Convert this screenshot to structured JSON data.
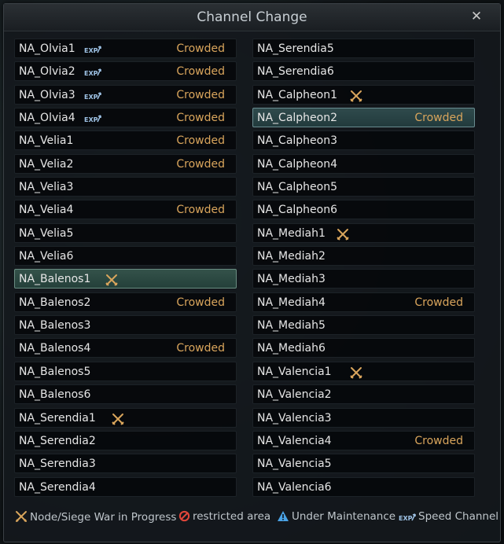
{
  "window": {
    "title": "Channel Change"
  },
  "left_channels": [
    {
      "name": "NA_Olvia1",
      "status": "Crowded",
      "exp": true
    },
    {
      "name": "NA_Olvia2",
      "status": "Crowded",
      "exp": true
    },
    {
      "name": "NA_Olvia3",
      "status": "Crowded",
      "exp": true
    },
    {
      "name": "NA_Olvia4",
      "status": "Crowded",
      "exp": true
    },
    {
      "name": "NA_Velia1",
      "status": "Crowded"
    },
    {
      "name": "NA_Velia2",
      "status": "Crowded"
    },
    {
      "name": "NA_Velia3",
      "status": ""
    },
    {
      "name": "NA_Velia4",
      "status": "Crowded"
    },
    {
      "name": "NA_Velia5",
      "status": ""
    },
    {
      "name": "NA_Velia6",
      "status": ""
    },
    {
      "name": "NA_Balenos1",
      "status": "",
      "war": true,
      "selected": true
    },
    {
      "name": "NA_Balenos2",
      "status": "Crowded"
    },
    {
      "name": "NA_Balenos3",
      "status": ""
    },
    {
      "name": "NA_Balenos4",
      "status": "Crowded"
    },
    {
      "name": "NA_Balenos5",
      "status": ""
    },
    {
      "name": "NA_Balenos6",
      "status": ""
    },
    {
      "name": "NA_Serendia1",
      "status": "",
      "war": true
    },
    {
      "name": "NA_Serendia2",
      "status": ""
    },
    {
      "name": "NA_Serendia3",
      "status": ""
    },
    {
      "name": "NA_Serendia4",
      "status": ""
    }
  ],
  "right_channels": [
    {
      "name": "NA_Serendia5",
      "status": ""
    },
    {
      "name": "NA_Serendia6",
      "status": ""
    },
    {
      "name": "NA_Calpheon1",
      "status": "",
      "war": true
    },
    {
      "name": "NA_Calpheon2",
      "status": "Crowded",
      "selected": true
    },
    {
      "name": "NA_Calpheon3",
      "status": ""
    },
    {
      "name": "NA_Calpheon4",
      "status": ""
    },
    {
      "name": "NA_Calpheon5",
      "status": ""
    },
    {
      "name": "NA_Calpheon6",
      "status": ""
    },
    {
      "name": "NA_Mediah1",
      "status": "",
      "war": true
    },
    {
      "name": "NA_Mediah2",
      "status": ""
    },
    {
      "name": "NA_Mediah3",
      "status": ""
    },
    {
      "name": "NA_Mediah4",
      "status": "Crowded"
    },
    {
      "name": "NA_Mediah5",
      "status": ""
    },
    {
      "name": "NA_Mediah6",
      "status": ""
    },
    {
      "name": "NA_Valencia1",
      "status": "",
      "war": true
    },
    {
      "name": "NA_Valencia2",
      "status": ""
    },
    {
      "name": "NA_Valencia3",
      "status": ""
    },
    {
      "name": "NA_Valencia4",
      "status": "Crowded"
    },
    {
      "name": "NA_Valencia5",
      "status": ""
    },
    {
      "name": "NA_Valencia6",
      "status": ""
    }
  ],
  "legend": {
    "war": "Node/Siege War in Progress",
    "restricted": "restricted area",
    "maintenance": "Under Maintenance",
    "speed": "Speed Channel"
  },
  "icons": {
    "war": "crossed-swords-icon",
    "restricted": "prohibited-icon",
    "maintenance": "warning-triangle-icon",
    "speed": "exp-icon",
    "close": "close-icon"
  },
  "colors": {
    "crowded": "#d9a55c",
    "war_icon": "#d9a55c",
    "restricted_icon": "#e0463a",
    "maintenance_icon": "#4aa3e6",
    "exp_icon": "#9fc3e6"
  }
}
